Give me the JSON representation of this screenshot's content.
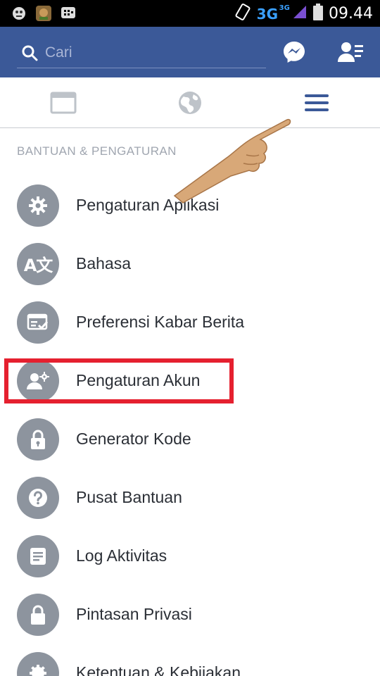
{
  "status_bar": {
    "network": "3G",
    "network_sup": "3G",
    "time": "09.44"
  },
  "search": {
    "placeholder": "Cari"
  },
  "header": {
    "icons": [
      "messenger-icon",
      "friend-requests-icon"
    ]
  },
  "tabs": [
    "news-feed-tab",
    "notifications-globe-tab",
    "menu-tab"
  ],
  "section": {
    "title": "BANTUAN & PENGATURAN"
  },
  "menu_items": [
    {
      "label": "Pengaturan Aplikasi",
      "icon": "gear-icon"
    },
    {
      "label": "Bahasa",
      "icon": "translate-icon"
    },
    {
      "label": "Preferensi Kabar Berita",
      "icon": "news-feed-preferences-icon"
    },
    {
      "label": "Pengaturan Akun",
      "icon": "account-settings-icon"
    },
    {
      "label": "Generator Kode",
      "icon": "lock-icon"
    },
    {
      "label": "Pusat Bantuan",
      "icon": "help-icon"
    },
    {
      "label": "Log Aktivitas",
      "icon": "activity-log-icon"
    },
    {
      "label": "Pintasan Privasi",
      "icon": "privacy-lock-icon"
    },
    {
      "label": "Ketentuan & Kebijakan",
      "icon": "terms-icon"
    }
  ],
  "colors": {
    "header": "#3b5998",
    "accent_tab": "#3b5998",
    "highlight": "#e5202f",
    "icon_bg": "#8d949e"
  }
}
